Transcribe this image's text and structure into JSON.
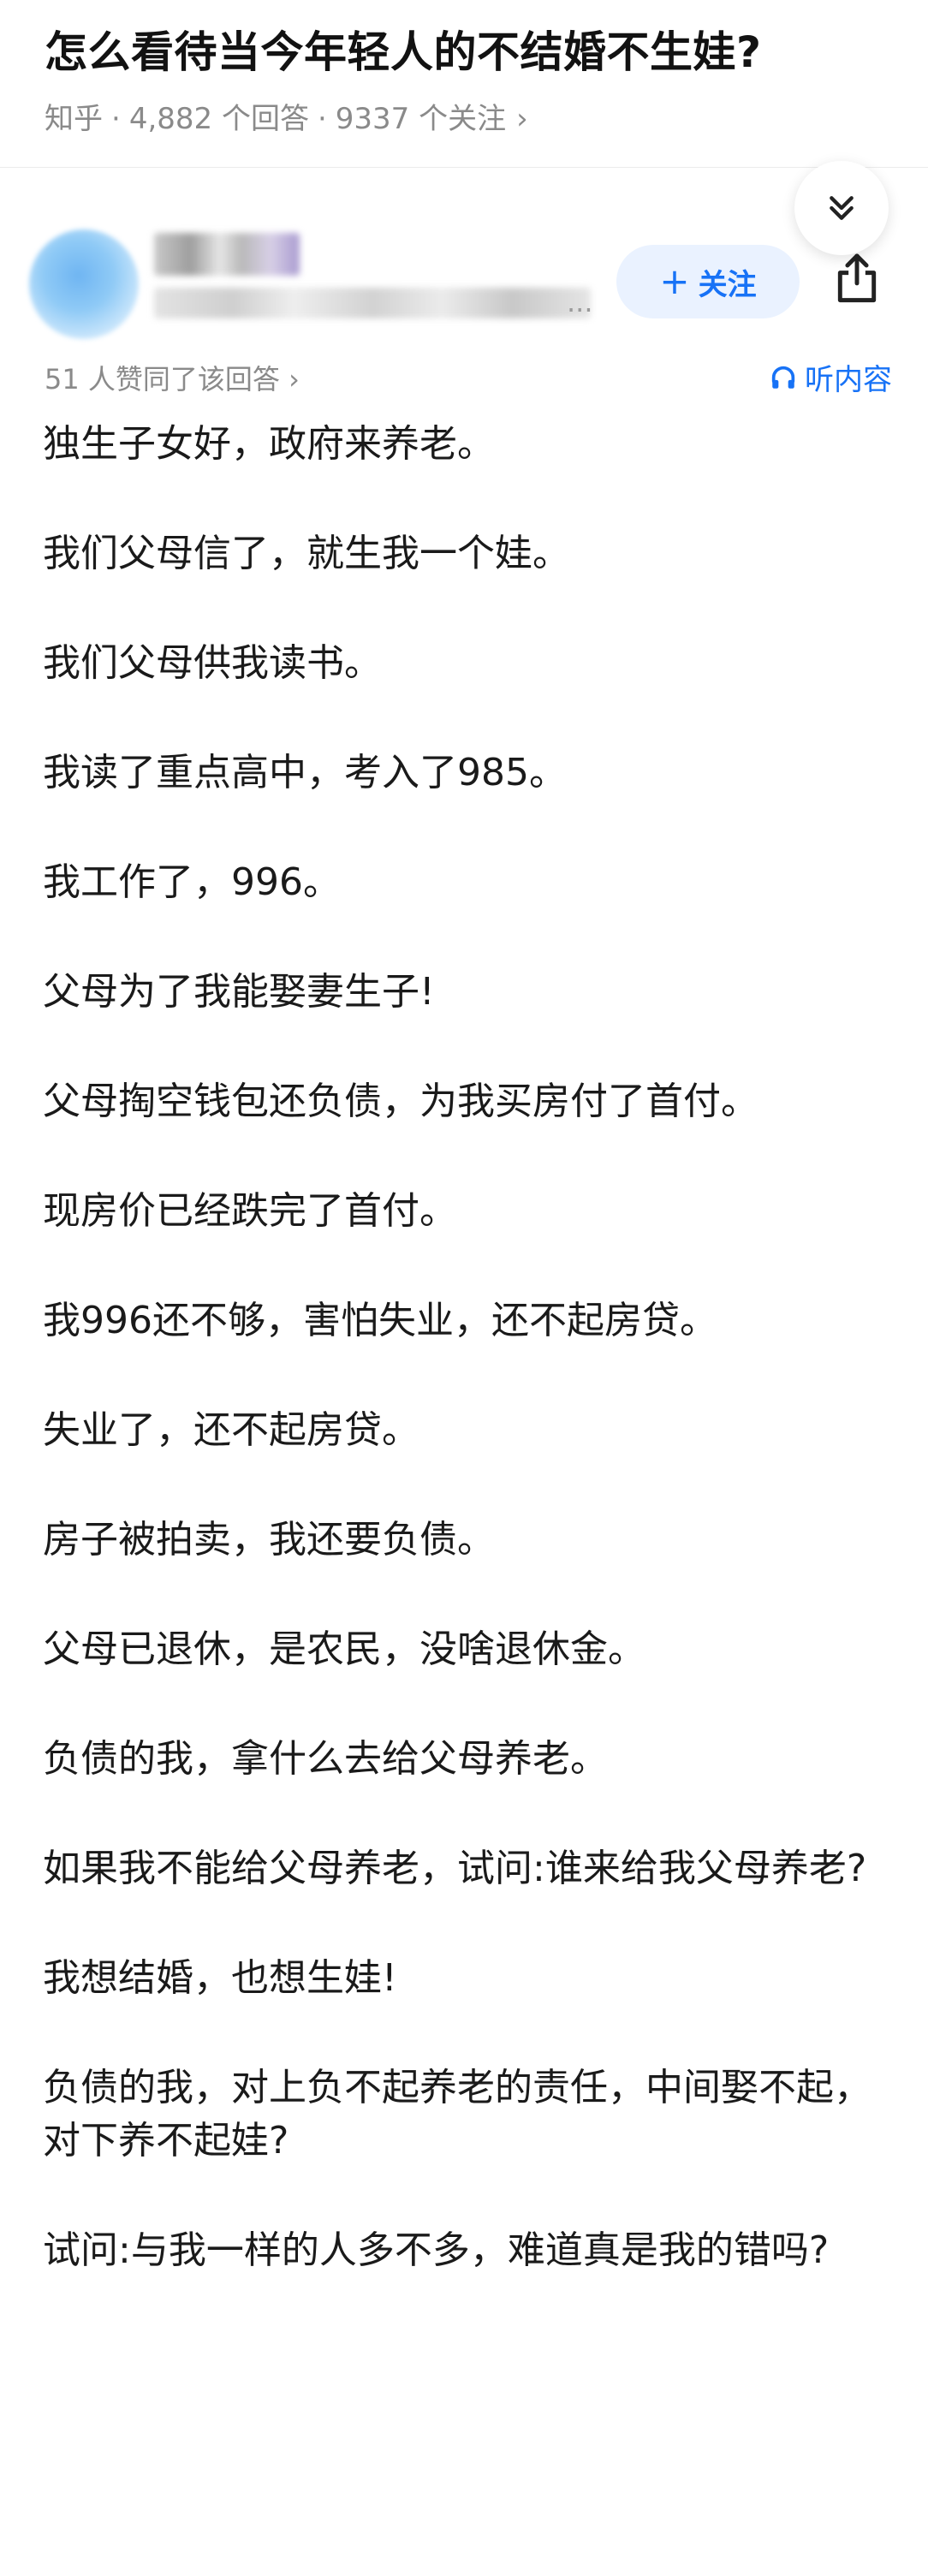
{
  "question": {
    "title": "怎么看待当今年轻人的不结婚不生娃?",
    "site": "知乎",
    "answers_count": "4,882 个回答",
    "followers_count": "9337 个关注",
    "separator": "·",
    "chevron": "›"
  },
  "author": {
    "follow_plus": "+",
    "follow_label": "关注",
    "bio_ellipsis": "..."
  },
  "answer_meta": {
    "votes_text": "51 人赞同了该回答",
    "votes_chevron": "›",
    "listen_label": "听内容"
  },
  "answer": {
    "paragraphs": [
      "独生子女好，政府来养老。",
      "我们父母信了，就生我一个娃。",
      "我们父母供我读书。",
      "我读了重点高中，考入了985。",
      "我工作了，996。",
      "父母为了我能娶妻生子!",
      "父母掏空钱包还负债，为我买房付了首付。",
      "现房价已经跌完了首付。",
      "我996还不够，害怕失业，还不起房贷。",
      "失业了，还不起房贷。",
      "房子被拍卖，我还要负债。",
      "父母已退休，是农民，没啥退休金。",
      "负债的我，拿什么去给父母养老。",
      "如果我不能给父母养老，试问:谁来给我父母养老?",
      "我想结婚，也想生娃!",
      "负债的我，对上负不起养老的责任，中间娶不起，对下养不起娃?",
      "试问:与我一样的人多不多，难道真是我的错吗?"
    ]
  },
  "colors": {
    "accent": "#1772f6",
    "follow_bg": "#eaf2ff",
    "meta_gray": "#8a8a8a",
    "text": "#1a1a1a"
  },
  "icons": {
    "collapse": "chevron-double-down-icon",
    "share": "share-icon",
    "listen": "headphones-icon"
  }
}
